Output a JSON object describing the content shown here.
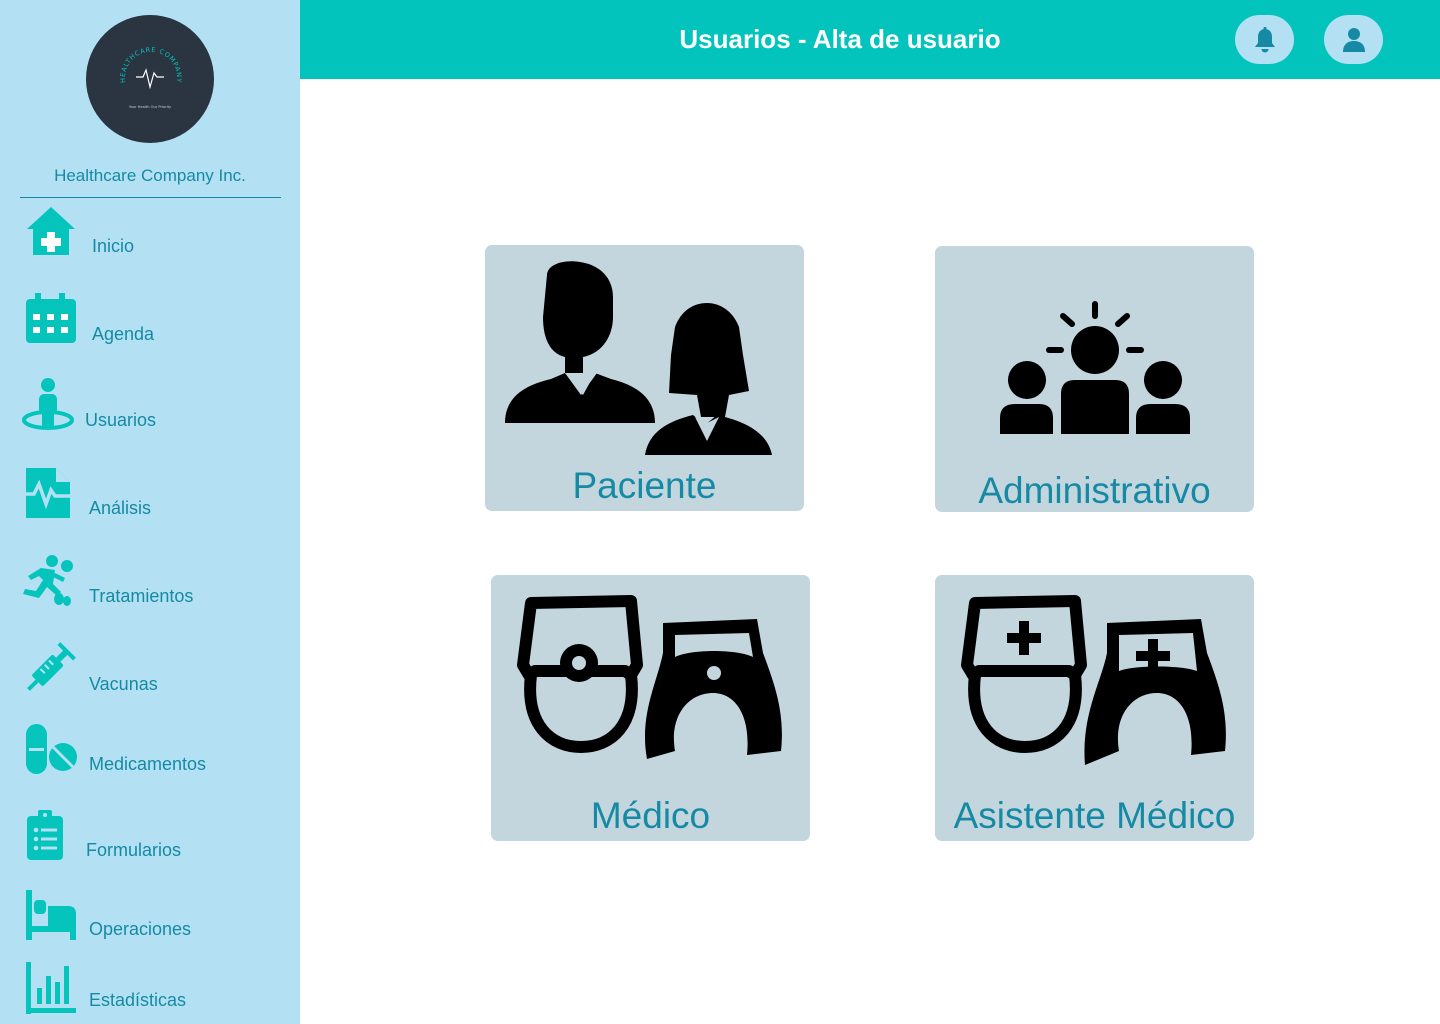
{
  "brand": {
    "logo_text": "HEALTHCARE COMPANY",
    "logo_tagline": "Your Health Our Priority",
    "company_name": "Healthcare Company Inc."
  },
  "header": {
    "title": "Usuarios - Alta de usuario",
    "notifications_icon": "bell-icon",
    "profile_icon": "user-icon"
  },
  "sidebar": {
    "items": [
      {
        "label": "Inicio",
        "icon": "home-medical-icon"
      },
      {
        "label": "Agenda",
        "icon": "calendar-icon"
      },
      {
        "label": "Usuarios",
        "icon": "user-location-icon"
      },
      {
        "label": "Análisis",
        "icon": "medical-file-icon"
      },
      {
        "label": "Tratamientos",
        "icon": "running-person-icon"
      },
      {
        "label": "Vacunas",
        "icon": "syringe-icon"
      },
      {
        "label": "Medicamentos",
        "icon": "pills-icon"
      },
      {
        "label": "Formularios",
        "icon": "clipboard-list-icon"
      },
      {
        "label": "Operaciones",
        "icon": "hospital-bed-icon"
      },
      {
        "label": "Estadísticas",
        "icon": "bar-chart-icon"
      }
    ]
  },
  "user_types": [
    {
      "label": "Paciente",
      "icon": "patients-icon"
    },
    {
      "label": "Administrativo",
      "icon": "team-leader-icon"
    },
    {
      "label": "Médico",
      "icon": "doctors-icon"
    },
    {
      "label": "Asistente Médico",
      "icon": "nurses-icon"
    }
  ],
  "colors": {
    "sidebar_bg": "#b3e1f3",
    "header_bg": "#02c4bc",
    "accent_text": "#168aa4",
    "icon_teal": "#04c4bc",
    "card_bg": "#c3d6de"
  }
}
